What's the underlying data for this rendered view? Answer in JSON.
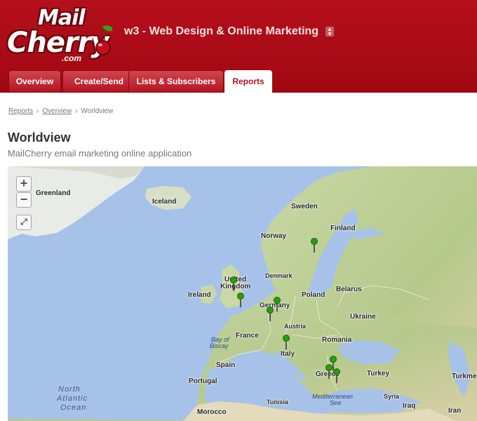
{
  "header": {
    "logo": {
      "line1": "Mail",
      "line2": "Cherry",
      "dotcom": ".com"
    },
    "account_title": "w3 - Web Design & Online Marketing",
    "account_toggle_icon": "updown-arrows-icon",
    "brand_color": "#a90a15"
  },
  "tabs": [
    {
      "label": "Overview",
      "active": false
    },
    {
      "label": "Create/Send",
      "active": false
    },
    {
      "label": "Lists & Subscribers",
      "active": false
    },
    {
      "label": "Reports",
      "active": true
    }
  ],
  "breadcrumb": {
    "items": [
      "Reports",
      "Overview"
    ],
    "current": "Worldview",
    "separator": "›"
  },
  "page": {
    "title": "Worldview",
    "subtitle": "MailCherry email marketing online application"
  },
  "map": {
    "controls": {
      "zoom_in": "+",
      "zoom_out": "−",
      "fullscreen_icon": "fullscreen-icon"
    },
    "labels": {
      "greenland": "Greenland",
      "iceland": "Iceland",
      "sweden": "Sweden",
      "finland": "Finland",
      "norway": "Norway",
      "united": "United",
      "kingdom": "Kingdom",
      "denmark": "Denmark",
      "ireland": "Ireland",
      "belarus": "Belarus",
      "poland": "Poland",
      "germany": "Germany",
      "ukraine": "Ukraine",
      "austria": "Austria",
      "france": "France",
      "bay": "Bay of",
      "biscay": "Biscay",
      "romania": "Romania",
      "spain": "Spain",
      "italy": "Italy",
      "portugal": "Portugal",
      "greece": "Greece",
      "turkey": "Turkey",
      "north": "North",
      "atlantic": "Atlantic",
      "ocean": "Ocean",
      "morocco": "Morocco",
      "tunisia": "Tunisia",
      "mediterranean": "Mediterranean",
      "sea": "Sea",
      "syria": "Syria",
      "iraq": "Iraq",
      "iran": "Iran",
      "turkm": "Turkme"
    },
    "marker_count": 9,
    "marker_color": "#2f9a10"
  }
}
